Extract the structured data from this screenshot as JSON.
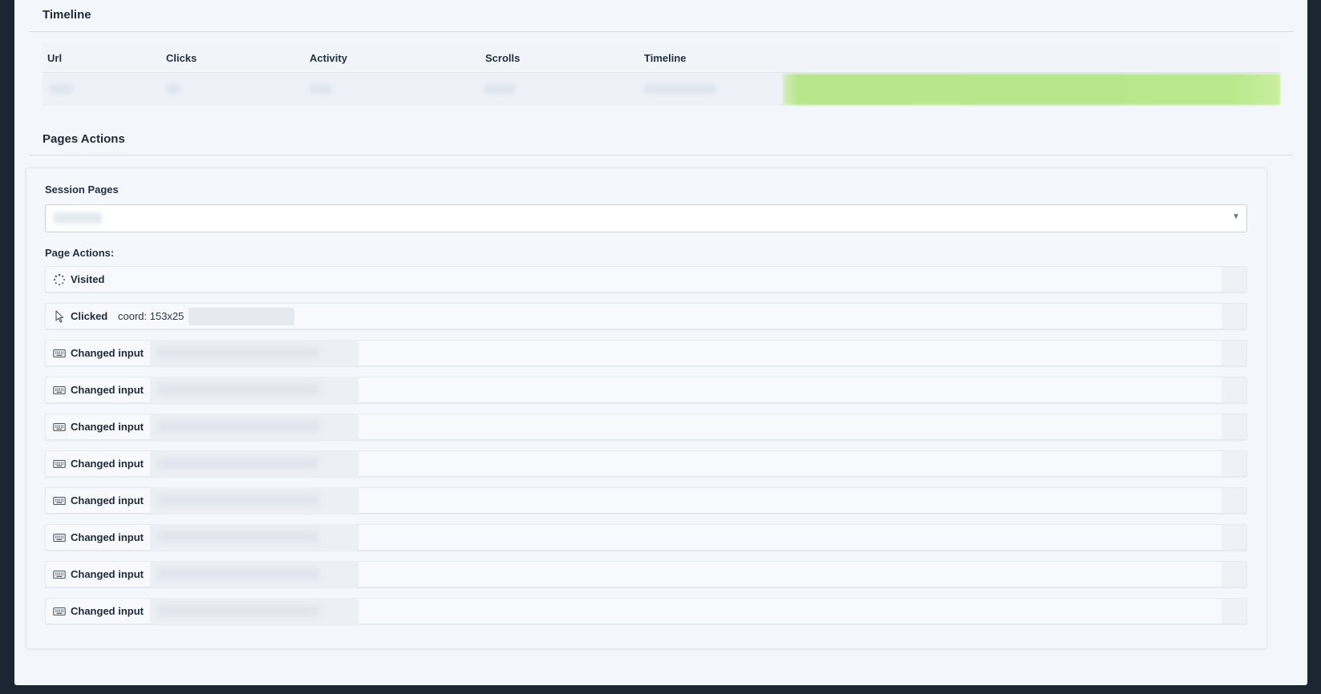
{
  "timeline": {
    "title": "Timeline",
    "columns": [
      "Url",
      "Clicks",
      "Activity",
      "Scrolls",
      "Timeline"
    ]
  },
  "pages_actions": {
    "title": "Pages Actions",
    "session_pages_label": "Session Pages",
    "page_actions_label": "Page Actions:",
    "actions": [
      {
        "icon": "spinner-icon",
        "title": "Visited",
        "detail": ""
      },
      {
        "icon": "cursor-icon",
        "title": "Clicked",
        "detail": "coord: 153x25"
      },
      {
        "icon": "keyboard-icon",
        "title": "Changed input",
        "detail": ""
      },
      {
        "icon": "keyboard-icon",
        "title": "Changed input",
        "detail": ""
      },
      {
        "icon": "keyboard-icon",
        "title": "Changed input",
        "detail": ""
      },
      {
        "icon": "keyboard-icon",
        "title": "Changed input",
        "detail": ""
      },
      {
        "icon": "keyboard-icon",
        "title": "Changed input",
        "detail": ""
      },
      {
        "icon": "keyboard-icon",
        "title": "Changed input",
        "detail": ""
      },
      {
        "icon": "keyboard-icon",
        "title": "Changed input",
        "detail": ""
      },
      {
        "icon": "keyboard-icon",
        "title": "Changed input",
        "detail": ""
      }
    ]
  },
  "colors": {
    "background": "#1b2633",
    "panel": "#f3f7fc",
    "timeline_bar": "#b9e88c"
  }
}
